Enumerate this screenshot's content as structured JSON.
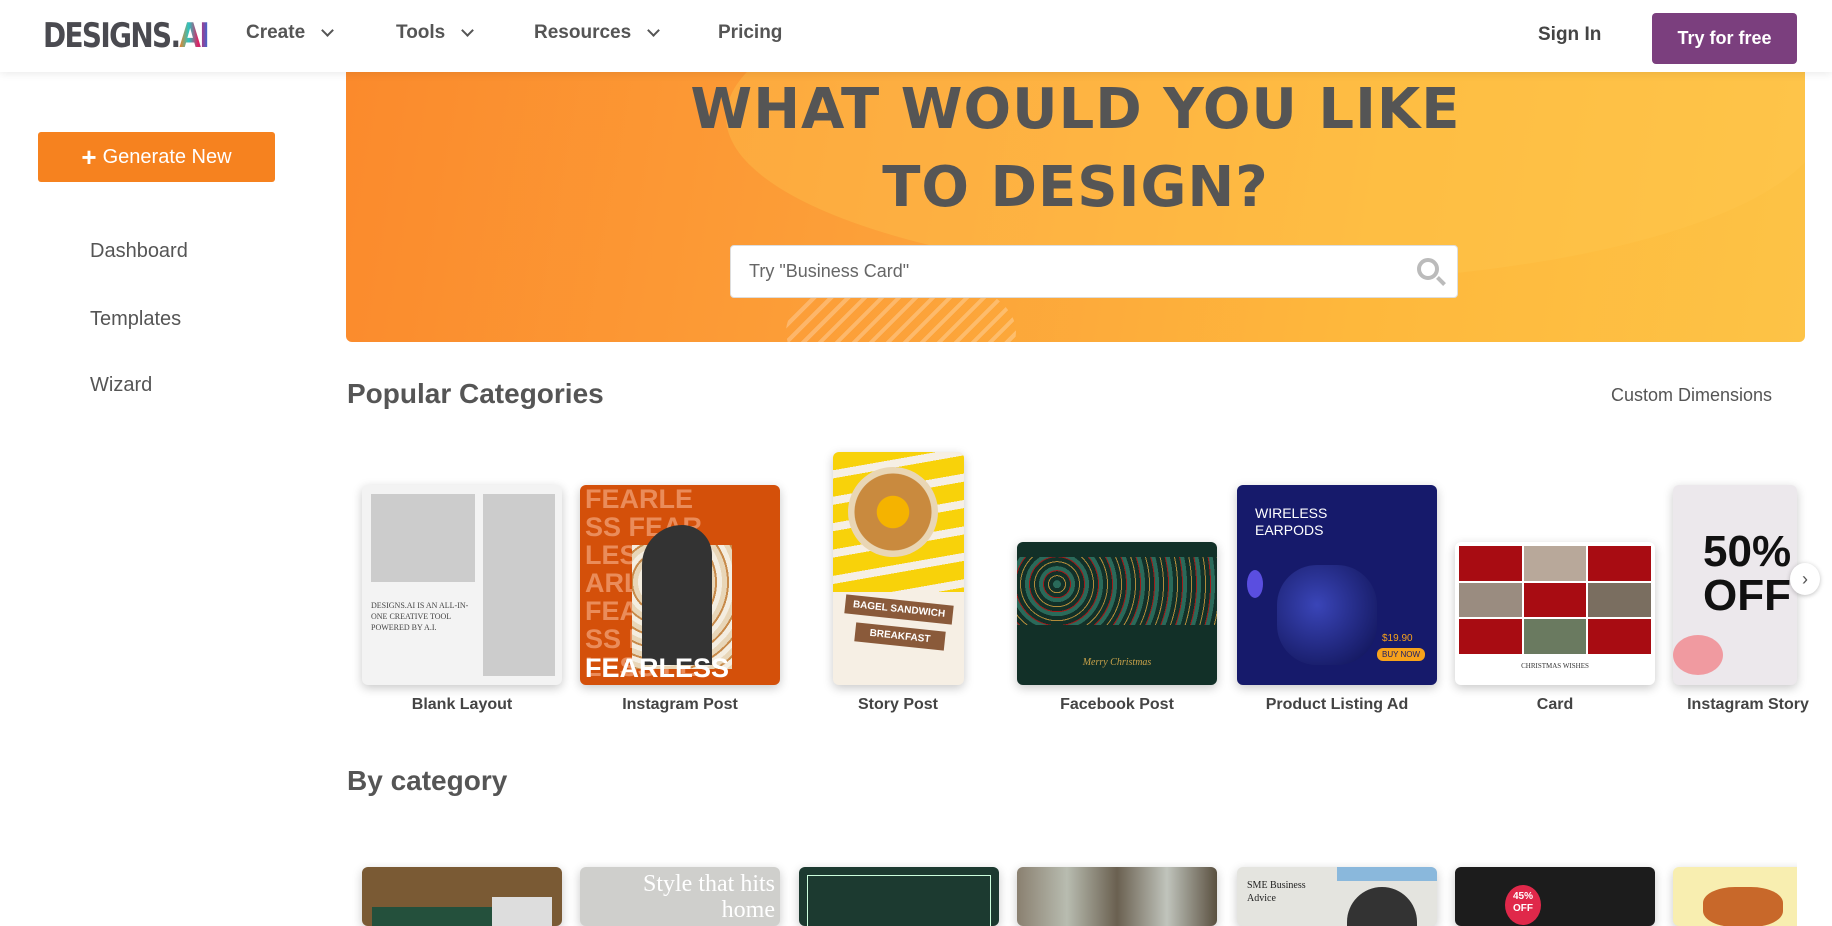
{
  "header": {
    "logo": "DESIGNS.",
    "logo_ai": "AI",
    "nav": [
      {
        "label": "Create"
      },
      {
        "label": "Tools"
      },
      {
        "label": "Resources"
      },
      {
        "label": "Pricing"
      }
    ],
    "sign_in": "Sign In",
    "try_free": "Try for free"
  },
  "sidebar": {
    "generate": "Generate New",
    "items": [
      {
        "label": "Dashboard"
      },
      {
        "label": "Templates"
      },
      {
        "label": "Wizard"
      }
    ]
  },
  "hero": {
    "line1": "WHAT WOULD YOU LIKE",
    "line2": "TO DESIGN?",
    "search_placeholder": "Try \"Business Card\""
  },
  "popular": {
    "title": "Popular Categories",
    "custom": "Custom Dimensions",
    "cards": [
      {
        "label": "Blank Layout",
        "text": "DESIGNS.AI IS AN ALL-IN-ONE CREATIVE TOOL POWERED BY A.I."
      },
      {
        "label": "Instagram Post",
        "text": "FEARLESS"
      },
      {
        "label": "Story Post",
        "text": "BAGEL SANDWICH",
        "text2": "BREAKFAST"
      },
      {
        "label": "Facebook Post",
        "text": "Merry Christmas"
      },
      {
        "label": "Product Listing Ad",
        "text": "WIRELESS EARPODS",
        "price": "$19.90",
        "cta": "BUY NOW"
      },
      {
        "label": "Card",
        "text": "CHRISTMAS WISHES"
      },
      {
        "label": "Instagram Story",
        "text": "50% OFF"
      }
    ]
  },
  "by_category": {
    "title": "By category",
    "cards": [
      {
        "text": ""
      },
      {
        "text": "Style that hits home"
      },
      {
        "text": ""
      },
      {
        "text": ""
      },
      {
        "text": "SME Business Advice"
      },
      {
        "text": "45% OFF"
      },
      {
        "text": ""
      }
    ]
  },
  "colors": {
    "accent": "#f6821f",
    "brand": "#7b3f7e"
  }
}
